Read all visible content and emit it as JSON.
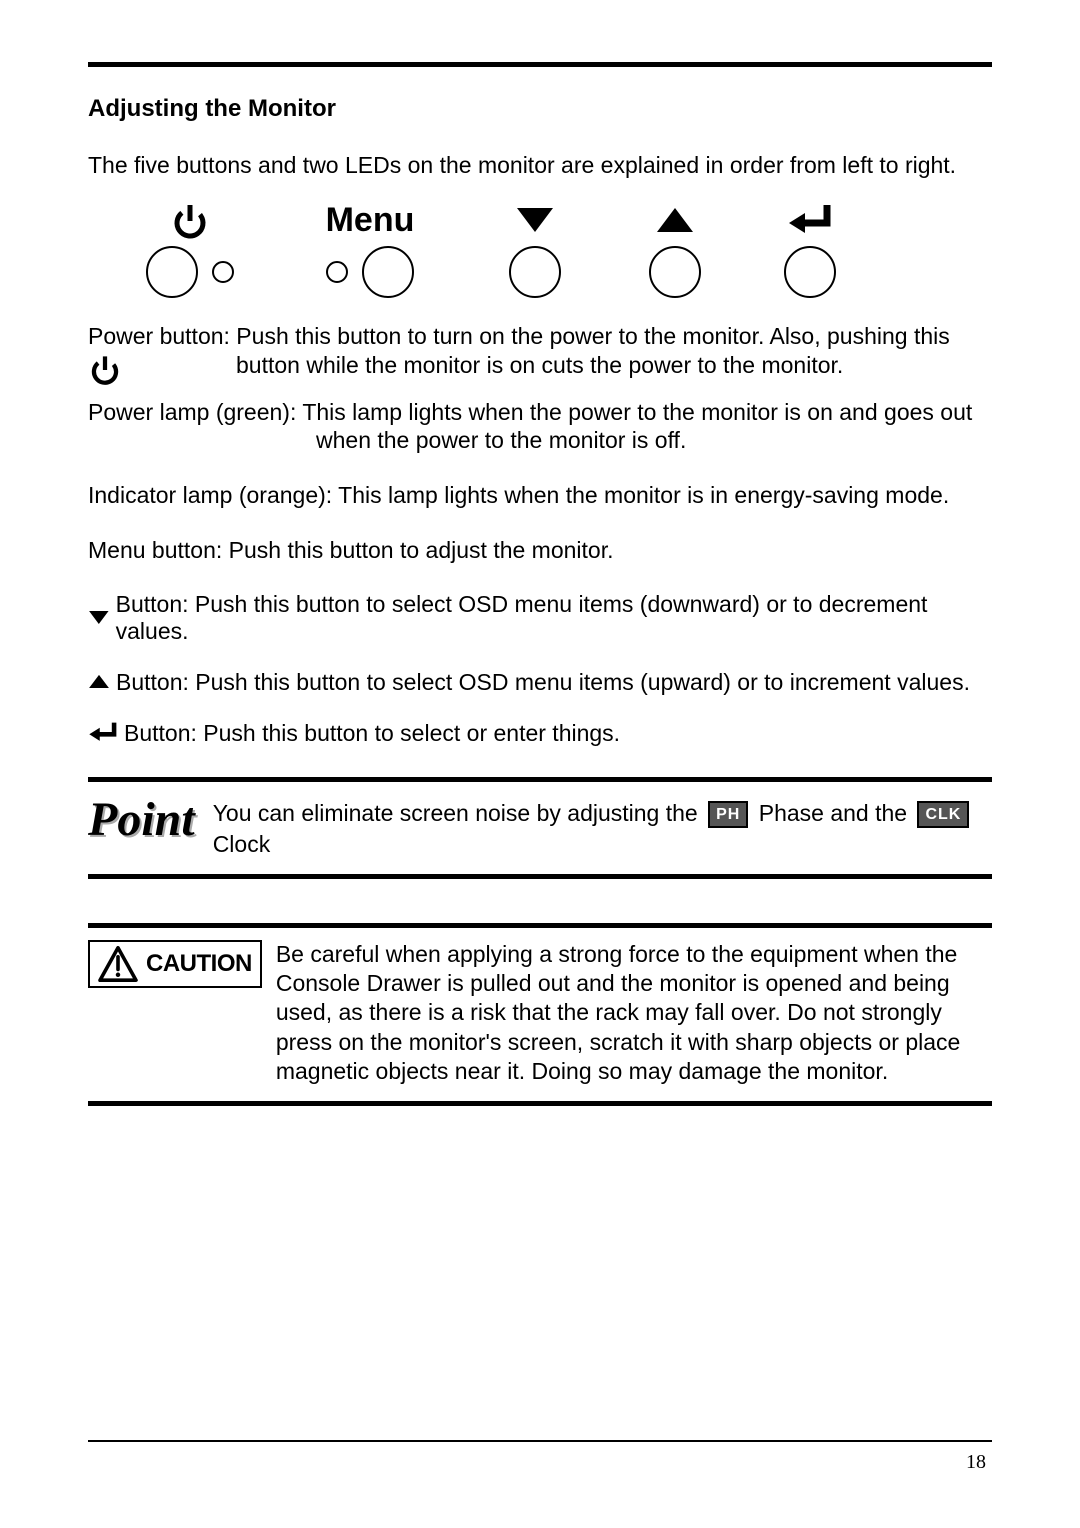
{
  "title": "Adjusting the Monitor",
  "intro": "The five buttons and two LEDs on the monitor are explained in order from left to right.",
  "buttons_row": {
    "menu_label": "Menu"
  },
  "power_button": {
    "label": "Power button: Push this button to turn on the power to the monitor. Also, pushing this",
    "cont": "button while the monitor is on cuts the power to the monitor."
  },
  "power_lamp": {
    "line1": "Power lamp (green): This lamp lights when the power to the monitor is on and goes out",
    "line2": "when the power to the monitor is off."
  },
  "indicator_lamp": "Indicator lamp (orange): This lamp lights when the monitor is in energy-saving mode.",
  "menu_button": "Menu button: Push this button to adjust the monitor.",
  "down_button": "Button: Push this button to select OSD menu items (downward) or to decrement values.",
  "up_button": "Button: Push this button to select OSD menu items (upward) or to increment values.",
  "enter_button": "Button: Push this button to select or enter things.",
  "point": {
    "pre": "You can eliminate screen noise by adjusting the",
    "ph_chip": "PH",
    "mid": "Phase and the",
    "clk_chip": "CLK",
    "clock": "Clock"
  },
  "caution": {
    "label": "CAUTION",
    "text": "Be careful when applying a strong force to the equipment when the Console Drawer is pulled out and the monitor is opened and being used, as there is a risk that the rack may fall over. Do not strongly press on the monitor's screen, scratch it with sharp objects or place magnetic objects near it. Doing so may damage the monitor."
  },
  "page_number": "18"
}
